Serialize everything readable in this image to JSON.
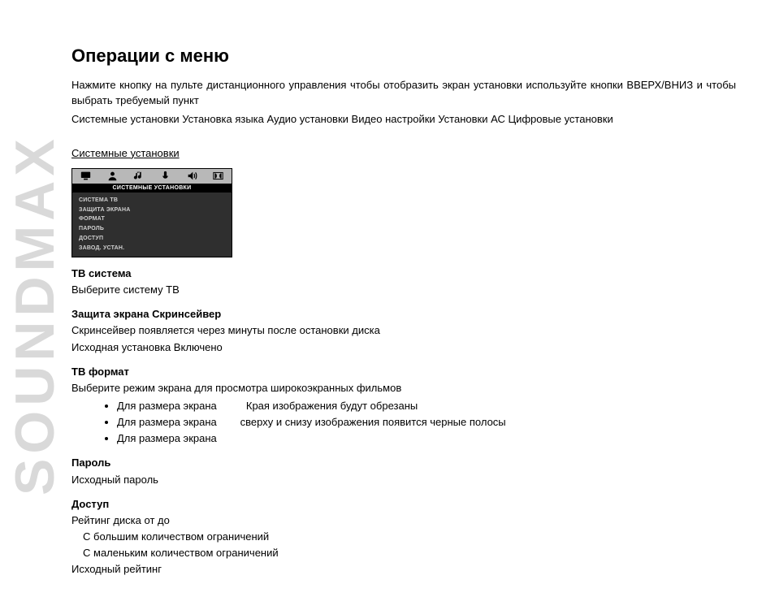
{
  "brand": "SOUNDMAX",
  "title": "Операции с меню",
  "intro": {
    "p1": "Нажмите кнопку        на пульте дистанционного управления  чтобы отобразить экран установки  используйте кнопки ВВЕРХ/ВНИЗ и         чтобы выбрать требуемый пункт",
    "p2": "Системные установки  Установка языка  Аудио установки  Видео настройки  Установки АС  Цифровые установки"
  },
  "system_settings_label": "Системные установки",
  "screenshot": {
    "header": "СИСТЕМНЫЕ УСТАНОВКИ",
    "items": [
      "СИСТЕМА ТВ",
      "ЗАЩИТА ЭКРАНА",
      "ФОРМАТ",
      "ПАРОЛЬ",
      "ДОСТУП",
      "ЗАВОД. УСТАН."
    ]
  },
  "sections": {
    "tv_system": {
      "label": "ТВ система",
      "line": "Выберите систему ТВ"
    },
    "screensaver": {
      "label": "Защита экрана  Скринсейвер",
      "line1": "Скринсейвер появляется через   минуты после остановки диска",
      "line2": "Исходная установка  Включено"
    },
    "tv_format": {
      "label": "ТВ формат",
      "line": "Выберите режим экрана для просмотра широкоэкранных фильмов",
      "bullets": [
        {
          "a": "Для размера экрана",
          "b": "Края изображения будут обрезаны"
        },
        {
          "a": "Для размера экрана",
          "b": "сверху и снизу изображения появится черные полосы"
        },
        {
          "a": "Для размера экрана",
          "b": ""
        }
      ]
    },
    "password": {
      "label": "Пароль",
      "line": "Исходный пароль"
    },
    "access": {
      "label": "Доступ",
      "line1": "Рейтинг диска от   до",
      "sub1": "С большим количеством ограничений",
      "sub2": "С маленьким количеством ограничений",
      "line2": "Исходный рейтинг"
    }
  }
}
